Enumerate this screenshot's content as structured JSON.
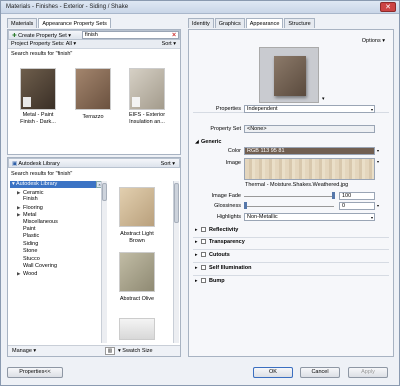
{
  "window": {
    "title": "Materials - Finishes - Exterior - Siding / Shake",
    "close_glyph": "✕"
  },
  "left": {
    "tabs": [
      "Materials",
      "Appearance Property Sets"
    ],
    "toolbar": {
      "create_label": "Create Property Set",
      "search_value": "finish",
      "project_label": "Project Property Sets: All",
      "sort_label": "Sort"
    },
    "results_label": "Search results for \"finish\"",
    "results": [
      {
        "name": "Metal - Paint Finish - Dark...",
        "swatch": "#4a3f33"
      },
      {
        "name": "Terrazzo",
        "swatch": "#8b6d58"
      },
      {
        "name": "EIFS - Exterior Insulation an...",
        "swatch": "#b9b2a6"
      }
    ],
    "library": {
      "label": "Autodesk Library",
      "sort_label": "Sort",
      "results_label": "Search results for \"finish\""
    },
    "tree": {
      "root": "Autodesk Library",
      "items": [
        {
          "label": "Ceramic",
          "arrow": "▶"
        },
        {
          "label": "Finish",
          "arrow": ""
        },
        {
          "label": "Flooring",
          "arrow": "▶"
        },
        {
          "label": "Metal",
          "arrow": "▶"
        },
        {
          "label": "Miscellaneous",
          "arrow": ""
        },
        {
          "label": "Paint",
          "arrow": ""
        },
        {
          "label": "Plastic",
          "arrow": ""
        },
        {
          "label": "Siding",
          "arrow": ""
        },
        {
          "label": "Stone",
          "arrow": ""
        },
        {
          "label": "Stucco",
          "arrow": ""
        },
        {
          "label": "Wall Covering",
          "arrow": ""
        },
        {
          "label": "Wood",
          "arrow": "▶"
        }
      ]
    },
    "library_results": [
      {
        "name": "Abstract Light Brown",
        "swatch": "#d8c4a4"
      },
      {
        "name": "Abstract Olive",
        "swatch": "#b8b29a"
      }
    ],
    "manage_label": "Manage",
    "swatch_size_label": "Swatch Size"
  },
  "right": {
    "tabs": [
      "Identity",
      "Graphics",
      "Appearance",
      "Structure"
    ],
    "options_label": "Options",
    "properties": {
      "label": "Properties",
      "value": "Independent"
    },
    "property_set": {
      "label": "Property Set",
      "value": "<None>"
    },
    "generic": {
      "title": "Generic",
      "color_label": "Color",
      "color_value": "RGB 113 95 81",
      "color_hex": "#715f51",
      "image_label": "Image",
      "image_name": "Thermal - Moisture.Shakes.Weathered.jpg",
      "fade_label": "Image Fade",
      "fade_value": "100",
      "gloss_label": "Glossiness",
      "gloss_value": "0",
      "highlights_label": "Highlights",
      "highlights_value": "Non-Metallic"
    },
    "categories": [
      "Reflectivity",
      "Transparency",
      "Cutouts",
      "Self Illumination",
      "Bump"
    ]
  },
  "footer": {
    "properties_button": "Properties<<",
    "ok": "OK",
    "cancel": "Cancel",
    "apply": "Apply"
  }
}
